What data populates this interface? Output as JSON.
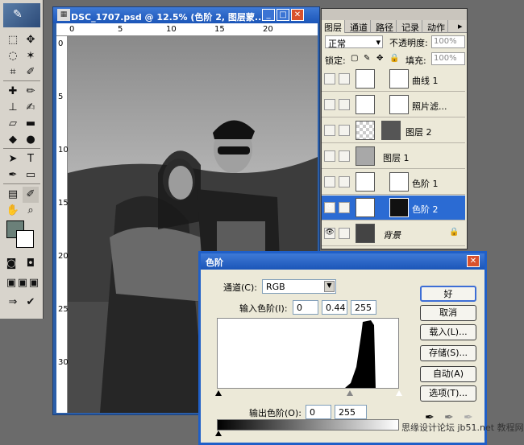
{
  "document": {
    "title": "DSC_1707.psd @ 12.5% (色阶 2, 图层蒙...",
    "ruler_top_labels": [
      "0",
      "5",
      "10",
      "15",
      "20"
    ],
    "ruler_left_labels": [
      "0",
      "5",
      "10",
      "15",
      "20",
      "25",
      "30"
    ]
  },
  "layers_panel": {
    "tabs": [
      "图层",
      "通道",
      "路径",
      "记录",
      "动作"
    ],
    "blend_mode": "正常",
    "opacity_label": "不透明度:",
    "opacity_value": "100%",
    "lock_label": "锁定:",
    "fill_label": "填充:",
    "fill_value": "100%",
    "layers": [
      {
        "name": "曲线 1",
        "selected": false
      },
      {
        "name": "照片滤...",
        "selected": false
      },
      {
        "name": "图层 2",
        "selected": false
      },
      {
        "name": "图层 1",
        "selected": false
      },
      {
        "name": "色阶 1",
        "selected": false
      },
      {
        "name": "色阶 2",
        "selected": true
      },
      {
        "name": "背景",
        "selected": false
      }
    ]
  },
  "levels_dialog": {
    "title": "色阶",
    "channel_label": "通道(C):",
    "channel_value": "RGB",
    "input_label": "输入色阶(I):",
    "input_black": "0",
    "input_gamma": "0.44",
    "input_white": "255",
    "output_label": "输出色阶(O):",
    "output_black": "0",
    "output_white": "255",
    "buttons": {
      "ok": "好",
      "cancel": "取消",
      "load": "载入(L)...",
      "save": "存储(S)...",
      "auto": "自动(A)",
      "options": "选项(T)..."
    }
  },
  "watermark": "思缘设计论坛 jb51.net 教程网"
}
